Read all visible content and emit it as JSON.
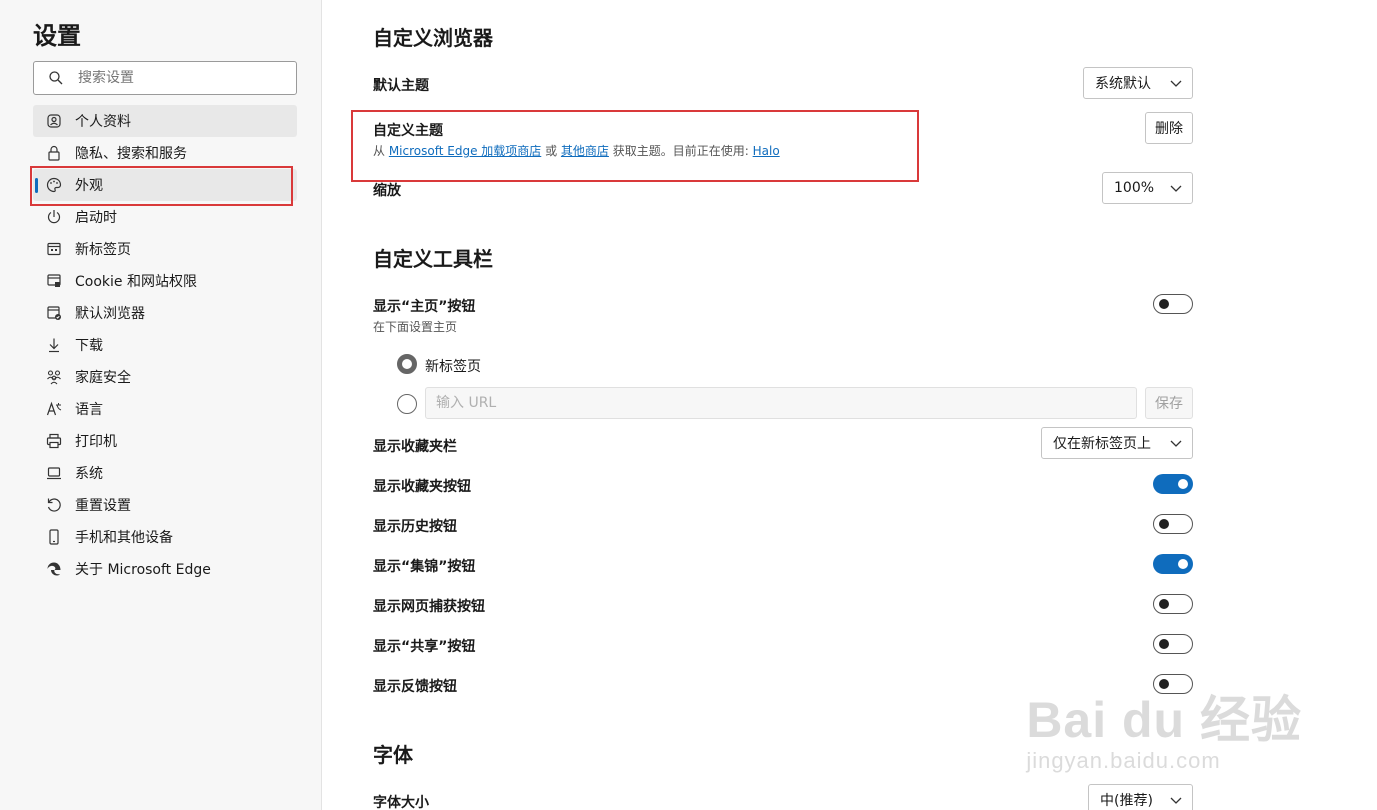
{
  "sidebar": {
    "title": "设置",
    "search_placeholder": "搜索设置",
    "items": [
      {
        "label": "个人资料",
        "icon": "profile-icon"
      },
      {
        "label": "隐私、搜索和服务",
        "icon": "lock-icon"
      },
      {
        "label": "外观",
        "icon": "palette-icon"
      },
      {
        "label": "启动时",
        "icon": "power-icon"
      },
      {
        "label": "新标签页",
        "icon": "new-tab-icon"
      },
      {
        "label": "Cookie 和网站权限",
        "icon": "site-permissions-icon"
      },
      {
        "label": "默认浏览器",
        "icon": "default-browser-icon"
      },
      {
        "label": "下载",
        "icon": "download-icon"
      },
      {
        "label": "家庭安全",
        "icon": "family-icon"
      },
      {
        "label": "语言",
        "icon": "language-icon"
      },
      {
        "label": "打印机",
        "icon": "printer-icon"
      },
      {
        "label": "系统",
        "icon": "laptop-icon"
      },
      {
        "label": "重置设置",
        "icon": "reset-icon"
      },
      {
        "label": "手机和其他设备",
        "icon": "phone-icon"
      },
      {
        "label": "关于 Microsoft Edge",
        "icon": "edge-logo-icon"
      }
    ],
    "selected_index": 2
  },
  "browser_section": {
    "title": "自定义浏览器",
    "default_theme_label": "默认主题",
    "default_theme_value": "系统默认",
    "custom_theme_label": "自定义主题",
    "custom_theme_prefix": "从 ",
    "custom_theme_link1": "Microsoft Edge 加载项商店",
    "custom_theme_or": " 或 ",
    "custom_theme_link2": "其他商店",
    "custom_theme_mid": " 获取主题。目前正在使用: ",
    "custom_theme_link3": "Halo",
    "delete_label": "删除",
    "zoom_label": "缩放",
    "zoom_value": "100%"
  },
  "toolbar_section": {
    "title": "自定义工具栏",
    "home_button_label": "显示“主页”按钮",
    "home_button_sub": "在下面设置主页",
    "home_button_on": false,
    "radio_new_tab_label": "新标签页",
    "url_placeholder": "输入 URL",
    "save_label": "保存",
    "favorites_bar_label": "显示收藏夹栏",
    "favorites_bar_value": "仅在新标签页上",
    "toggles": [
      {
        "label": "显示收藏夹按钮",
        "on": true
      },
      {
        "label": "显示历史按钮",
        "on": false
      },
      {
        "label": "显示“集锦”按钮",
        "on": true
      },
      {
        "label": "显示网页捕获按钮",
        "on": false
      },
      {
        "label": "显示“共享”按钮",
        "on": false
      },
      {
        "label": "显示反馈按钮",
        "on": false
      }
    ]
  },
  "font_section": {
    "title": "字体",
    "font_size_label": "字体大小",
    "font_size_value": "中(推荐)"
  },
  "watermark": {
    "main": "Bai du 经验",
    "sub": "jingyan.baidu.com"
  },
  "colors": {
    "accent": "#0f6cbd",
    "highlight_box": "#d9393a"
  }
}
